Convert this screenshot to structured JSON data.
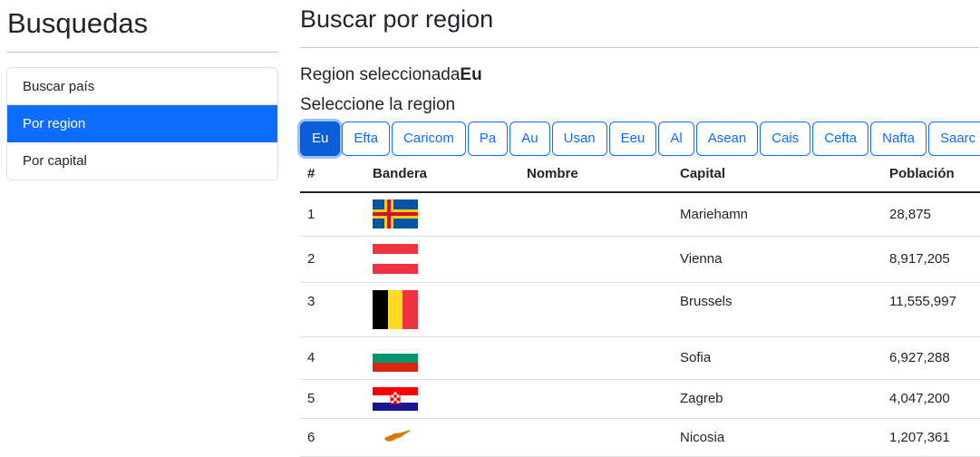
{
  "sidebar": {
    "title": "Busquedas",
    "items": [
      {
        "label": "Buscar país",
        "active": false
      },
      {
        "label": "Por region",
        "active": true
      },
      {
        "label": "Por capital",
        "active": false
      }
    ]
  },
  "main": {
    "title": "Buscar por region",
    "selected_label": "Region seleccionada",
    "selected_value": "Eu",
    "choose_label": "Seleccione la region",
    "regions": [
      "Eu",
      "Efta",
      "Caricom",
      "Pa",
      "Au",
      "Usan",
      "Eeu",
      "Al",
      "Asean",
      "Cais",
      "Cefta",
      "Nafta",
      "Saarc"
    ],
    "table": {
      "headers": [
        "#",
        "Bandera",
        "Nombre",
        "Capital",
        "Población"
      ],
      "rows": [
        {
          "num": "1",
          "flag": "aland-flag",
          "nombre": "",
          "capital": "Mariehamn",
          "poblacion": "28,875"
        },
        {
          "num": "2",
          "flag": "austria-flag",
          "nombre": "",
          "capital": "Vienna",
          "poblacion": "8,917,205"
        },
        {
          "num": "3",
          "flag": "belgium-flag",
          "nombre": "",
          "capital": "Brussels",
          "poblacion": "11,555,997"
        },
        {
          "num": "4",
          "flag": "bulgaria-flag",
          "nombre": "",
          "capital": "Sofia",
          "poblacion": "6,927,288"
        },
        {
          "num": "5",
          "flag": "croatia-flag",
          "nombre": "",
          "capital": "Zagreb",
          "poblacion": "4,047,200"
        },
        {
          "num": "6",
          "flag": "cyprus-flag",
          "nombre": "",
          "capital": "Nicosia",
          "poblacion": "1,207,361"
        }
      ]
    }
  },
  "colors": {
    "primary": "#0d6efd",
    "active_button": "#0b5ed7"
  }
}
